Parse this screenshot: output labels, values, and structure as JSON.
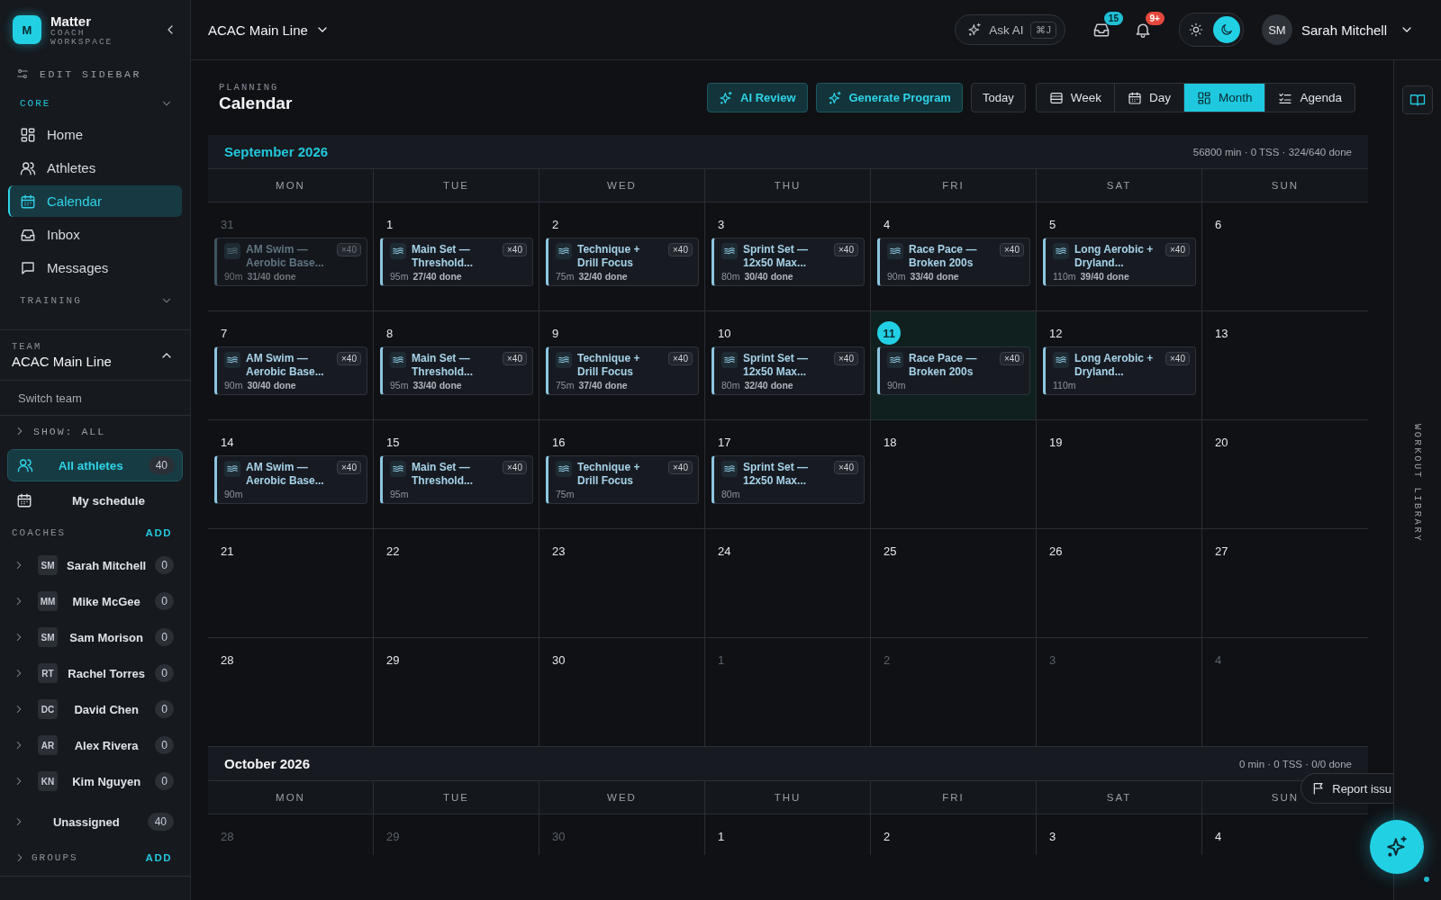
{
  "sidebar": {
    "brand": {
      "logo": "M",
      "name": "Matter",
      "subtitle": "COACH WORKSPACE"
    },
    "edit_label": "EDIT SIDEBAR",
    "sections": [
      {
        "title": "CORE",
        "active": true,
        "expanded": true,
        "items": [
          {
            "label": "Home",
            "kind": "home",
            "selected": false
          },
          {
            "label": "Athletes",
            "kind": "people",
            "selected": false
          },
          {
            "label": "Calendar",
            "kind": "calendar",
            "selected": true
          },
          {
            "label": "Inbox",
            "kind": "inbox",
            "selected": false
          },
          {
            "label": "Messages",
            "kind": "chat",
            "selected": false
          }
        ]
      },
      {
        "title": "TRAINING",
        "active": false,
        "expanded": true
      }
    ],
    "team": {
      "label": "TEAM",
      "name": "ACAC Main Line",
      "expanded": true,
      "switch_label": "Switch team"
    },
    "show_filter": "SHOW: ALL",
    "views": [
      {
        "label": "All athletes",
        "kind": "people",
        "count": "40",
        "selected": true
      },
      {
        "label": "My schedule",
        "kind": "calendar",
        "selected": false
      }
    ],
    "coaches": {
      "title": "COACHES",
      "add": "ADD",
      "items": [
        {
          "initials": "SM",
          "name": "Sarah Mitchell",
          "count": "0"
        },
        {
          "initials": "MM",
          "name": "Mike McGee",
          "count": "0"
        },
        {
          "initials": "SM",
          "name": "Sam Morison",
          "count": "0"
        },
        {
          "initials": "RT",
          "name": "Rachel Torres",
          "count": "0"
        },
        {
          "initials": "DC",
          "name": "David Chen",
          "count": "0"
        },
        {
          "initials": "AR",
          "name": "Alex Rivera",
          "count": "0"
        },
        {
          "initials": "KN",
          "name": "Kim Nguyen",
          "count": "0"
        }
      ]
    },
    "unassigned": {
      "label": "Unassigned",
      "count": "40"
    },
    "groups": {
      "title": "GROUPS",
      "add": "ADD"
    }
  },
  "topbar": {
    "team_selector": "ACAC Main Line",
    "ask_ai": {
      "label": "Ask AI",
      "shortcut": "⌘J"
    },
    "inbox_badge": "15",
    "notifications_badge": "9+",
    "theme": [
      {
        "kind": "light",
        "selected": false
      },
      {
        "kind": "dark",
        "selected": true
      }
    ],
    "user": {
      "initials": "SM",
      "name": "Sarah Mitchell"
    }
  },
  "page": {
    "eyebrow": "PLANNING",
    "title": "Calendar"
  },
  "actions": [
    {
      "label": "AI Review",
      "kind": "ai"
    },
    {
      "label": "Generate Program",
      "kind": "ai"
    },
    {
      "label": "Today",
      "kind": "plain"
    }
  ],
  "view_modes": [
    {
      "label": "Week",
      "kind": "table",
      "selected": false
    },
    {
      "label": "Day",
      "kind": "calendar",
      "selected": false
    },
    {
      "label": "Month",
      "kind": "home",
      "selected": true
    },
    {
      "label": "Agenda",
      "kind": "checklist",
      "selected": false
    }
  ],
  "months": [
    {
      "title": "September 2026",
      "current": true,
      "summary": "56800 min · 0 TSS · 324/640 done",
      "weekdays": [
        "MON",
        "TUE",
        "WED",
        "THU",
        "FRI",
        "SAT",
        "SUN"
      ],
      "weeks": [
        [
          {
            "day": "31",
            "outside": true,
            "today": false,
            "events": [
              {
                "title": "AM Swim — Aerobic Base...",
                "duration": "90m",
                "done": "31/40 done",
                "count": "×40"
              }
            ]
          },
          {
            "day": "1",
            "outside": false,
            "today": false,
            "events": [
              {
                "title": "Main Set — Threshold...",
                "duration": "95m",
                "done": "27/40 done",
                "count": "×40"
              }
            ]
          },
          {
            "day": "2",
            "outside": false,
            "today": false,
            "events": [
              {
                "title": "Technique + Drill Focus",
                "duration": "75m",
                "done": "32/40 done",
                "count": "×40"
              }
            ]
          },
          {
            "day": "3",
            "outside": false,
            "today": false,
            "events": [
              {
                "title": "Sprint Set — 12x50 Max...",
                "duration": "80m",
                "done": "30/40 done",
                "count": "×40"
              }
            ]
          },
          {
            "day": "4",
            "outside": false,
            "today": false,
            "events": [
              {
                "title": "Race Pace — Broken 200s",
                "duration": "90m",
                "done": "33/40 done",
                "count": "×40"
              }
            ]
          },
          {
            "day": "5",
            "outside": false,
            "today": false,
            "events": [
              {
                "title": "Long Aerobic + Dryland...",
                "duration": "110m",
                "done": "39/40 done",
                "count": "×40"
              }
            ]
          },
          {
            "day": "6",
            "outside": false,
            "today": false
          }
        ],
        [
          {
            "day": "7",
            "outside": false,
            "today": false,
            "events": [
              {
                "title": "AM Swim — Aerobic Base...",
                "duration": "90m",
                "done": "30/40 done",
                "count": "×40"
              }
            ]
          },
          {
            "day": "8",
            "outside": false,
            "today": false,
            "events": [
              {
                "title": "Main Set — Threshold...",
                "duration": "95m",
                "done": "33/40 done",
                "count": "×40"
              }
            ]
          },
          {
            "day": "9",
            "outside": false,
            "today": false,
            "events": [
              {
                "title": "Technique + Drill Focus",
                "duration": "75m",
                "done": "37/40 done",
                "count": "×40"
              }
            ]
          },
          {
            "day": "10",
            "outside": false,
            "today": false,
            "events": [
              {
                "title": "Sprint Set — 12x50 Max...",
                "duration": "80m",
                "done": "32/40 done",
                "count": "×40"
              }
            ]
          },
          {
            "day": "11",
            "outside": false,
            "today": true,
            "events": [
              {
                "title": "Race Pace — Broken 200s",
                "duration": "90m",
                "count": "×40"
              }
            ]
          },
          {
            "day": "12",
            "outside": false,
            "today": false,
            "events": [
              {
                "title": "Long Aerobic + Dryland...",
                "duration": "110m",
                "count": "×40"
              }
            ]
          },
          {
            "day": "13",
            "outside": false,
            "today": false
          }
        ],
        [
          {
            "day": "14",
            "outside": false,
            "today": false,
            "events": [
              {
                "title": "AM Swim — Aerobic Base...",
                "duration": "90m",
                "count": "×40"
              }
            ]
          },
          {
            "day": "15",
            "outside": false,
            "today": false,
            "events": [
              {
                "title": "Main Set — Threshold...",
                "duration": "95m",
                "count": "×40"
              }
            ]
          },
          {
            "day": "16",
            "outside": false,
            "today": false,
            "events": [
              {
                "title": "Technique + Drill Focus",
                "duration": "75m",
                "count": "×40"
              }
            ]
          },
          {
            "day": "17",
            "outside": false,
            "today": false,
            "events": [
              {
                "title": "Sprint Set — 12x50 Max...",
                "duration": "80m",
                "count": "×40"
              }
            ]
          },
          {
            "day": "18",
            "outside": false,
            "today": false
          },
          {
            "day": "19",
            "outside": false,
            "today": false
          },
          {
            "day": "20",
            "outside": false,
            "today": false
          }
        ],
        [
          {
            "day": "21",
            "outside": false,
            "today": false
          },
          {
            "day": "22",
            "outside": false,
            "today": false
          },
          {
            "day": "23",
            "outside": false,
            "today": false
          },
          {
            "day": "24",
            "outside": false,
            "today": false
          },
          {
            "day": "25",
            "outside": false,
            "today": false
          },
          {
            "day": "26",
            "outside": false,
            "today": false
          },
          {
            "day": "27",
            "outside": false,
            "today": false
          }
        ],
        [
          {
            "day": "28",
            "outside": false,
            "today": false
          },
          {
            "day": "29",
            "outside": false,
            "today": false
          },
          {
            "day": "30",
            "outside": false,
            "today": false
          },
          {
            "day": "1",
            "outside": true,
            "today": false
          },
          {
            "day": "2",
            "outside": true,
            "today": false
          },
          {
            "day": "3",
            "outside": true,
            "today": false
          },
          {
            "day": "4",
            "outside": true,
            "today": false
          }
        ]
      ]
    },
    {
      "title": "October 2026",
      "current": false,
      "summary": "0 min · 0 TSS · 0/0 done",
      "weekdays": [
        "MON",
        "TUE",
        "WED",
        "THU",
        "FRI",
        "SAT",
        "SUN"
      ],
      "weeks": [
        [
          {
            "day": "28",
            "outside": true,
            "today": false
          },
          {
            "day": "29",
            "outside": true,
            "today": false
          },
          {
            "day": "30",
            "outside": true,
            "today": false
          },
          {
            "day": "1",
            "outside": false,
            "today": false
          },
          {
            "day": "2",
            "outside": false,
            "today": false
          },
          {
            "day": "3",
            "outside": false,
            "today": false
          },
          {
            "day": "4",
            "outside": false,
            "today": false
          }
        ]
      ]
    }
  ],
  "right_rail": {
    "label": "WORKOUT LIBRARY"
  },
  "report_issue": "Report issu"
}
